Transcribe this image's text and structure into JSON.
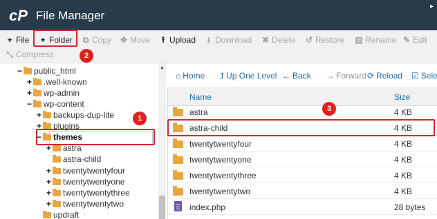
{
  "app": {
    "title": "File Manager",
    "logo_text": "cP"
  },
  "toolbar": {
    "row1": [
      {
        "key": "file",
        "label": "File",
        "icon": "plus-icon",
        "glyph": "+",
        "enabled": true
      },
      {
        "key": "folder",
        "label": "Folder",
        "icon": "plus-icon",
        "glyph": "+",
        "enabled": true
      },
      {
        "key": "copy",
        "label": "Copy",
        "icon": "copy-icon",
        "glyph": "⧉",
        "enabled": false
      },
      {
        "key": "move",
        "label": "Move",
        "icon": "move-icon",
        "glyph": "✥",
        "enabled": false
      },
      {
        "key": "upload",
        "label": "Upload",
        "icon": "upload-icon",
        "glyph": "⭱",
        "enabled": true
      },
      {
        "key": "download",
        "label": "Download",
        "icon": "download-icon",
        "glyph": "⭳",
        "enabled": false
      },
      {
        "key": "delete",
        "label": "Delete",
        "icon": "delete-icon",
        "glyph": "✖",
        "enabled": false
      },
      {
        "key": "restore",
        "label": "Restore",
        "icon": "restore-icon",
        "glyph": "↺",
        "enabled": false
      },
      {
        "key": "rename",
        "label": "Rename",
        "icon": "rename-icon",
        "glyph": "▤",
        "enabled": false
      },
      {
        "key": "edit",
        "label": "Edit",
        "icon": "pencil-icon",
        "glyph": "✎",
        "enabled": false
      }
    ],
    "row2": [
      {
        "key": "compress",
        "label": "Compress",
        "icon": "compress-icon",
        "glyph": "⤡",
        "enabled": false
      }
    ]
  },
  "tree": [
    {
      "label": "public_html",
      "toggle": "−",
      "depth": 0
    },
    {
      "label": ".well-known",
      "toggle": "+",
      "depth": 1
    },
    {
      "label": "wp-admin",
      "toggle": "+",
      "depth": 1
    },
    {
      "label": "wp-content",
      "toggle": "−",
      "depth": 1
    },
    {
      "label": "backups-dup-lite",
      "toggle": "+",
      "depth": 2
    },
    {
      "label": "plugins",
      "toggle": "+",
      "depth": 2
    },
    {
      "label": "themes",
      "toggle": "−",
      "depth": 2,
      "selected": true
    },
    {
      "label": "astra",
      "toggle": "+",
      "depth": 3
    },
    {
      "label": "astra-child",
      "toggle": "",
      "depth": 3
    },
    {
      "label": "twentytwentyfour",
      "toggle": "+",
      "depth": 3
    },
    {
      "label": "twentytwentyone",
      "toggle": "+",
      "depth": 3
    },
    {
      "label": "twentytwentythree",
      "toggle": "+",
      "depth": 3
    },
    {
      "label": "twentytwentytwo",
      "toggle": "+",
      "depth": 3
    },
    {
      "label": "updraft",
      "toggle": "",
      "depth": 2
    }
  ],
  "nav": [
    {
      "key": "home",
      "label": "Home",
      "icon": "home-icon",
      "glyph": "⌂",
      "enabled": true
    },
    {
      "key": "up",
      "label": "Up One Level",
      "icon": "up-level-icon",
      "glyph": "⮥",
      "enabled": true
    },
    {
      "key": "back",
      "label": "Back",
      "icon": "arrow-left-icon",
      "glyph": "←",
      "enabled": true
    },
    {
      "key": "forward",
      "label": "Forward",
      "icon": "arrow-right-icon",
      "glyph": "→",
      "enabled": false
    },
    {
      "key": "reload",
      "label": "Reload",
      "icon": "reload-icon",
      "glyph": "⟳",
      "enabled": true
    },
    {
      "key": "select",
      "label": "Sele",
      "icon": "checkbox-icon",
      "glyph": "☑",
      "enabled": true
    }
  ],
  "table": {
    "columns": {
      "name": "Name",
      "size": "Size"
    },
    "rows": [
      {
        "name": "astra",
        "size": "4 KB",
        "kind": "folder"
      },
      {
        "name": "astra-child",
        "size": "4 KB",
        "kind": "folder",
        "highlighted": true
      },
      {
        "name": "twentytwentyfour",
        "size": "4 KB",
        "kind": "folder"
      },
      {
        "name": "twentytwentyone",
        "size": "4 KB",
        "kind": "folder"
      },
      {
        "name": "twentytwentythree",
        "size": "4 KB",
        "kind": "folder"
      },
      {
        "name": "twentytwentytwo",
        "size": "4 KB",
        "kind": "folder"
      },
      {
        "name": "index.php",
        "size": "28 bytes",
        "kind": "php-file"
      }
    ]
  },
  "annotations": {
    "badge1": "1",
    "badge2": "2",
    "badge3": "3"
  },
  "colors": {
    "titlebar": "#293a4a",
    "accent": "#1e6fb3",
    "highlight": "#d9232e",
    "folder": "#e9a640"
  }
}
